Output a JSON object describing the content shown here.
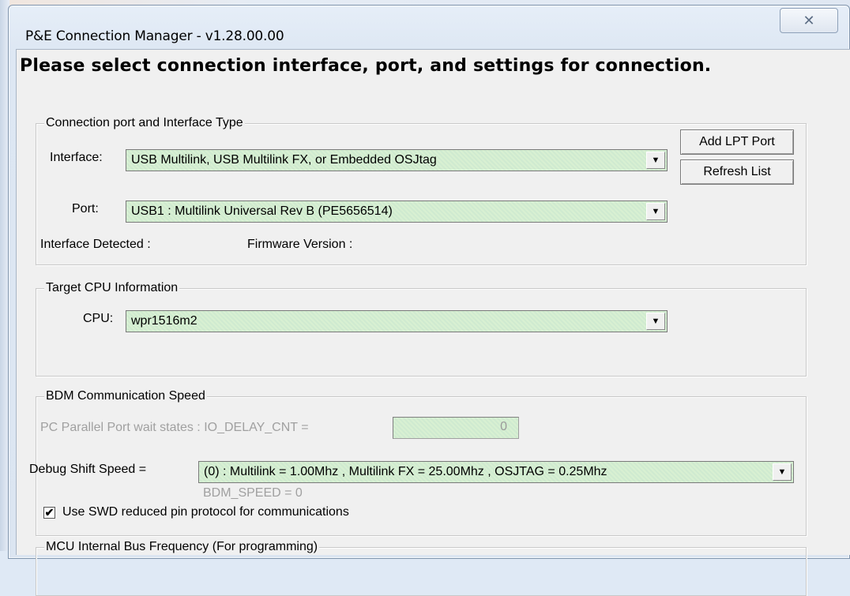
{
  "window": {
    "title": "P&E Connection Manager - v1.28.00.00",
    "close_glyph": "✕"
  },
  "heading": "Please select connection interface, port, and settings for connection.",
  "connection_group": {
    "legend": "Connection port and Interface Type",
    "interface_label": "Interface:",
    "interface_value": "USB Multilink, USB Multilink FX, or Embedded OSJtag",
    "port_label": "Port:",
    "port_value": "USB1 : Multilink Universal Rev B (PE5656514)",
    "interface_detected_label": "Interface Detected :",
    "firmware_version_label": "Firmware Version :",
    "add_lpt_button": "Add LPT Port",
    "refresh_button": "Refresh List"
  },
  "cpu_group": {
    "legend": "Target CPU Information",
    "cpu_label": "CPU:",
    "cpu_value": "wpr1516m2"
  },
  "bdm_group": {
    "legend": "BDM Communication Speed",
    "io_delay_label": "PC Parallel Port wait states : IO_DELAY_CNT =",
    "io_delay_value": "0",
    "shift_speed_label": "Debug Shift Speed =",
    "shift_speed_value": "(0)  :  Multilink = 1.00Mhz  ,  Multilink FX = 25.00Mhz  ,  OSJTAG = 0.25Mhz",
    "bdm_speed_text": "BDM_SPEED = 0",
    "swd_checkbox_label": "Use SWD reduced pin protocol for communications",
    "swd_checked_glyph": "✔"
  },
  "next_group": {
    "legend": "MCU Internal Bus Frequency (For programming)"
  },
  "dropdown_arrow_glyph": "▼",
  "colors": {
    "field_green": "#d8f0d2",
    "disabled_text": "#a0a0a0"
  }
}
